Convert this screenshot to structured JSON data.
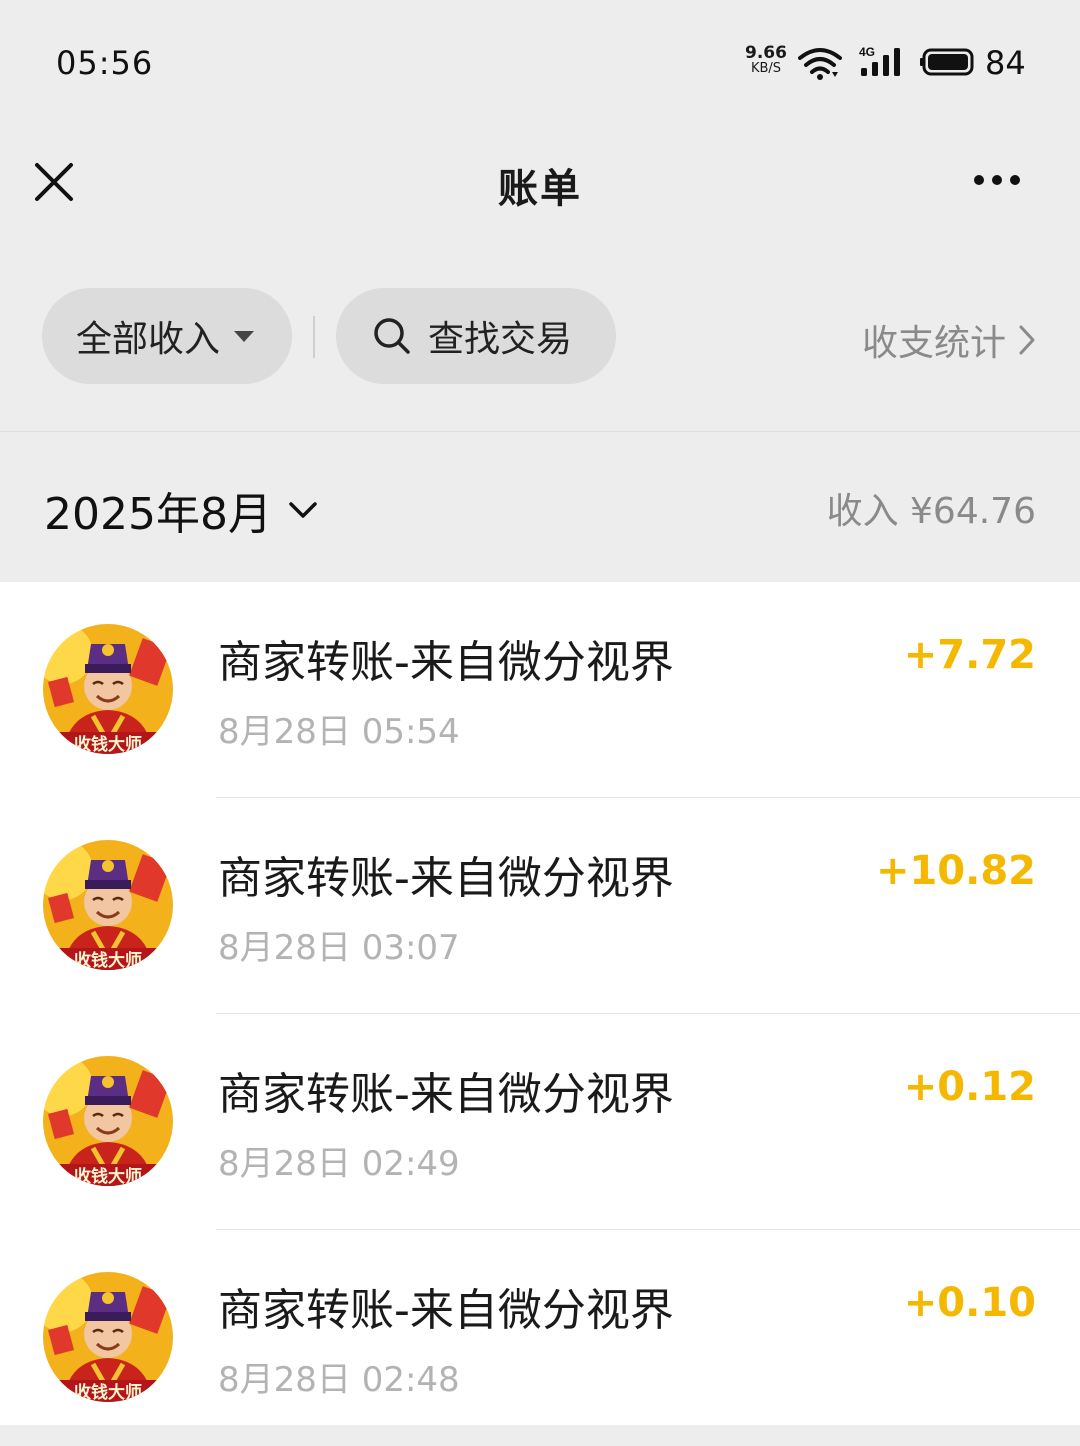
{
  "status_bar": {
    "time": "05:56",
    "net_speed_value": "9.66",
    "net_speed_unit": "KB/S",
    "signal_label": "4G",
    "battery": "84"
  },
  "nav": {
    "title": "账单"
  },
  "filters": {
    "all_label": "全部收入",
    "search_label": "查找交易",
    "stats_label": "收支统计"
  },
  "month": {
    "label": "2025年8月",
    "summary": "收入 ¥64.76"
  },
  "colors": {
    "amount": "#f5b800",
    "background": "#ededed"
  },
  "transactions": [
    {
      "title": "商家转账-来自微分视界",
      "time": "8月28日 05:54",
      "amount": "+7.72"
    },
    {
      "title": "商家转账-来自微分视界",
      "time": "8月28日 03:07",
      "amount": "+10.82"
    },
    {
      "title": "商家转账-来自微分视界",
      "time": "8月28日 02:49",
      "amount": "+0.12"
    },
    {
      "title": "商家转账-来自微分视界",
      "time": "8月28日 02:48",
      "amount": "+0.10"
    }
  ]
}
